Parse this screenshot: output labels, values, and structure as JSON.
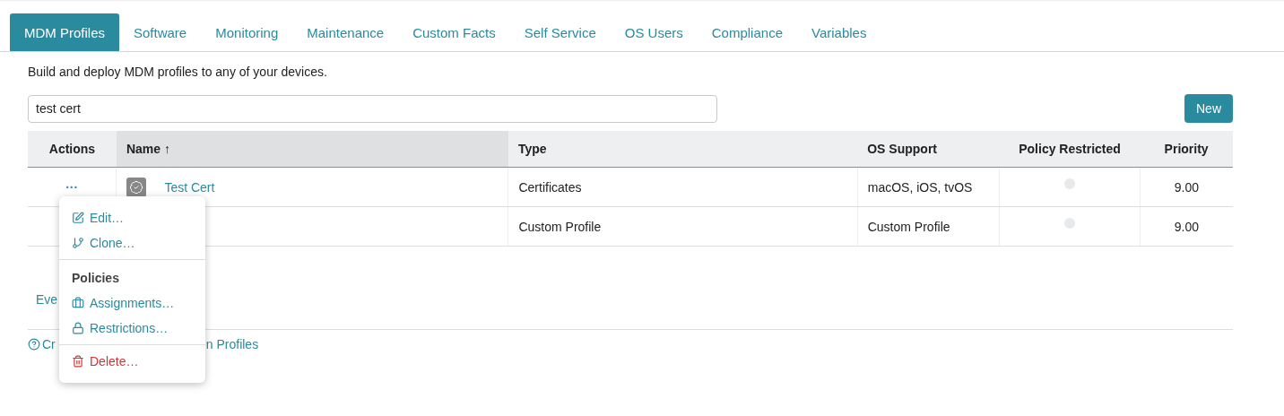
{
  "tabs": [
    {
      "label": "MDM Profiles",
      "selected": true
    },
    {
      "label": "Software",
      "selected": false
    },
    {
      "label": "Monitoring",
      "selected": false
    },
    {
      "label": "Maintenance",
      "selected": false
    },
    {
      "label": "Custom Facts",
      "selected": false
    },
    {
      "label": "Self Service",
      "selected": false
    },
    {
      "label": "OS Users",
      "selected": false
    },
    {
      "label": "Compliance",
      "selected": false
    },
    {
      "label": "Variables",
      "selected": false
    }
  ],
  "description": "Build and deploy MDM profiles to any of your devices.",
  "search": {
    "value": "test cert"
  },
  "new_button": "New",
  "table": {
    "columns": [
      {
        "label": "Actions",
        "sorted": false
      },
      {
        "label": "Name",
        "sorted": true,
        "sort_mark": "↑"
      },
      {
        "label": "Type",
        "sorted": false
      },
      {
        "label": "OS Support",
        "sorted": false
      },
      {
        "label": "Policy Restricted",
        "sorted": false
      },
      {
        "label": "Priority",
        "sorted": false
      }
    ],
    "rows": [
      {
        "actions": "···",
        "name": "Test Cert",
        "type": "Certificates",
        "os_support": "macOS, iOS, tvOS",
        "restricted": false,
        "priority": "9.00"
      },
      {
        "type": "Custom Profile",
        "os_support": "Custom Profile",
        "restricted": false,
        "priority": "9.00"
      }
    ]
  },
  "partial_link": "Eve",
  "footer_link": {
    "start": "Cr",
    "end": "n Profiles"
  },
  "action_menu": {
    "groups": [
      {
        "items": [
          {
            "label": "Edit…",
            "danger": false
          },
          {
            "label": "Clone…",
            "danger": false
          }
        ]
      },
      {
        "header": "Policies",
        "items": [
          {
            "label": "Assignments…",
            "danger": false
          },
          {
            "label": "Restrictions…",
            "danger": false
          }
        ]
      },
      {
        "items": [
          {
            "label": "Delete…",
            "danger": true
          }
        ]
      }
    ]
  }
}
